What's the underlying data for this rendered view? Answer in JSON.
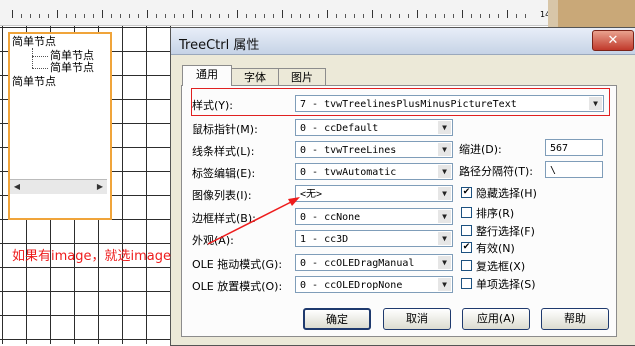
{
  "ruler": {
    "end_marks": "14"
  },
  "tree": {
    "nodes": [
      "简单节点",
      "简单节点",
      "简单节点",
      "简单节点"
    ]
  },
  "dialog": {
    "title": "TreeCtrl 属性",
    "close_symbol": "✕",
    "tabs": [
      "通用",
      "字体",
      "图片"
    ],
    "fields": [
      {
        "label": "样式(Y):",
        "value": "7 - tvwTreelinesPlusMinusPictureText"
      },
      {
        "label": "鼠标指针(M):",
        "value": "0 - ccDefault"
      },
      {
        "label": "线条样式(L):",
        "value": "0 - tvwTreeLines"
      },
      {
        "label": "标签编辑(E):",
        "value": "0 - tvwAutomatic"
      },
      {
        "label": "图像列表(I):",
        "value": "<无>"
      },
      {
        "label": "边框样式(B):",
        "value": "0 - ccNone"
      },
      {
        "label": "外观(A):",
        "value": "1 - cc3D"
      },
      {
        "label": "OLE 拖动模式(G):",
        "value": "0 - ccOLEDragManual"
      },
      {
        "label": "OLE 放置模式(O):",
        "value": "0 - ccOLEDropNone"
      }
    ],
    "indent": {
      "label": "缩进(D):",
      "value": "567"
    },
    "path_sep": {
      "label": "路径分隔符(T):",
      "value": "\\"
    },
    "checkboxes": [
      {
        "label": "隐藏选择(H)",
        "checked": true
      },
      {
        "label": "排序(R)",
        "checked": false
      },
      {
        "label": "整行选择(F)",
        "checked": false
      },
      {
        "label": "有效(N)",
        "checked": true
      },
      {
        "label": "复选框(X)",
        "checked": false
      },
      {
        "label": "单项选择(S)",
        "checked": false
      }
    ],
    "buttons": {
      "ok": "确定",
      "cancel": "取消",
      "apply": "应用(A)",
      "help": "帮助"
    }
  },
  "annotation": {
    "text": "如果有image，就选image",
    "color": "#ee1c1c"
  },
  "check_mark": "✔",
  "dropdown_arrow": "▼",
  "scroll_left": "◀",
  "scroll_right": "▶"
}
